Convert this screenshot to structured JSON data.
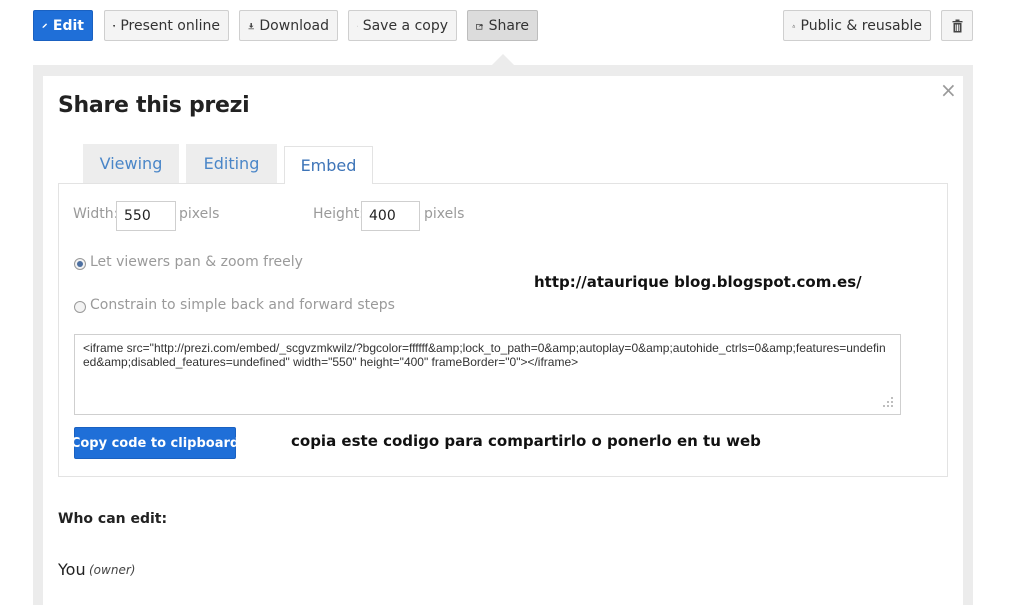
{
  "toolbar": {
    "edit_label": "Edit",
    "present_label": "Present online",
    "download_label": "Download",
    "save_copy_label": "Save a copy",
    "share_label": "Share",
    "license_label": "Public & reusable"
  },
  "dialog": {
    "title": "Share this prezi",
    "close_glyph": "×",
    "tabs": [
      {
        "label": "Viewing",
        "active": false
      },
      {
        "label": "Editing",
        "active": false
      },
      {
        "label": "Embed",
        "active": true
      }
    ],
    "embed": {
      "width_label": "Width:",
      "width_value": "550",
      "width_unit": "pixels",
      "height_label": "Height:",
      "height_value": "400",
      "height_unit": "pixels",
      "options": [
        {
          "label": "Let viewers pan & zoom freely",
          "selected": true
        },
        {
          "label": "Constrain to simple back and forward steps",
          "selected": false
        }
      ],
      "code": "<iframe src=\"http://prezi.com/embed/_scgvzmkwilz/?bgcolor=ffffff&amp;lock_to_path=0&amp;autoplay=0&amp;autohide_ctrls=0&amp;features=undefined&amp;disabled_features=undefined\" width=\"550\" height=\"400\" frameBorder=\"0\"></iframe>",
      "copy_button_label": "Copy code to clipboard"
    },
    "who_can_edit_label": "Who can edit:",
    "owner_name": "You",
    "owner_tag": "(owner)"
  },
  "annotations": {
    "blog_url": "http://ataurique blog.blogspot.com.es/",
    "instruction": "copia este codigo para compartirlo o ponerlo en tu web"
  },
  "colors": {
    "primary_button": "#1f6fd8",
    "tab_text": "#4a86c8",
    "panel_background": "#ececec"
  }
}
